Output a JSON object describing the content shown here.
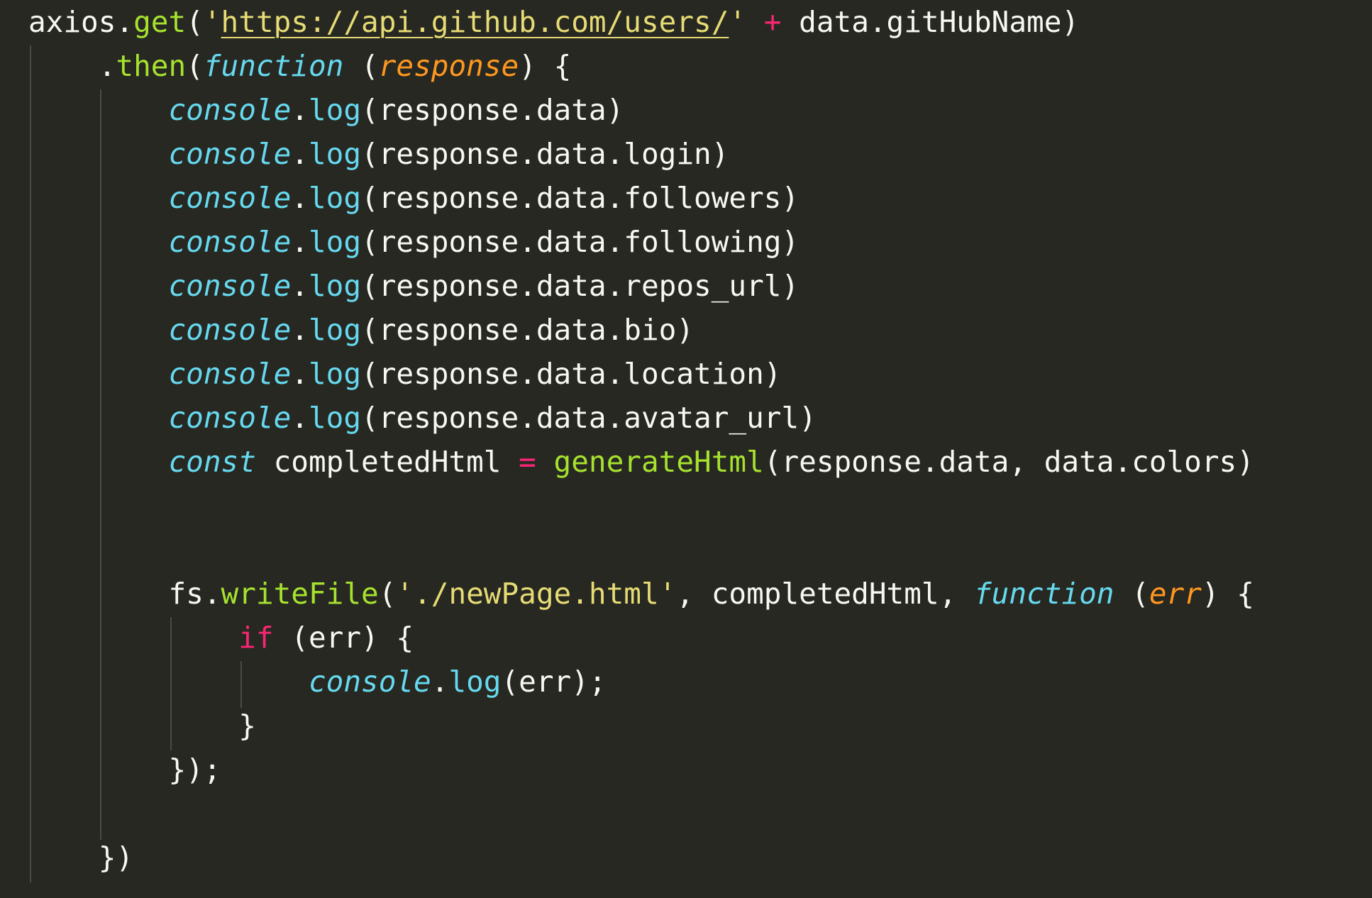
{
  "colors": {
    "background": "#272822",
    "plain": "#f8f8f2",
    "function": "#a6e22e",
    "string": "#e6db74",
    "operator": "#f92672",
    "keyword": "#66d9ef",
    "parameter": "#fd971f",
    "guide": "#4a4b44"
  },
  "lines": [
    [
      {
        "t": "plain",
        "v": "axios."
      },
      {
        "t": "func",
        "v": "get"
      },
      {
        "t": "plain",
        "v": "("
      },
      {
        "t": "str",
        "v": "'"
      },
      {
        "t": "url",
        "v": "https://api.github.com/users/"
      },
      {
        "t": "str",
        "v": "'"
      },
      {
        "t": "plain",
        "v": " "
      },
      {
        "t": "op",
        "v": "+"
      },
      {
        "t": "plain",
        "v": " data.gitHubName)"
      }
    ],
    [
      {
        "t": "plain",
        "v": "    ."
      },
      {
        "t": "func",
        "v": "then"
      },
      {
        "t": "plain",
        "v": "("
      },
      {
        "t": "kw",
        "v": "function"
      },
      {
        "t": "plain",
        "v": " ("
      },
      {
        "t": "param",
        "v": "response"
      },
      {
        "t": "plain",
        "v": ") {"
      }
    ],
    [
      {
        "t": "plain",
        "v": "        "
      },
      {
        "t": "obj",
        "v": "console"
      },
      {
        "t": "plain",
        "v": "."
      },
      {
        "t": "meth",
        "v": "log"
      },
      {
        "t": "plain",
        "v": "(response.data)"
      }
    ],
    [
      {
        "t": "plain",
        "v": "        "
      },
      {
        "t": "obj",
        "v": "console"
      },
      {
        "t": "plain",
        "v": "."
      },
      {
        "t": "meth",
        "v": "log"
      },
      {
        "t": "plain",
        "v": "(response.data.login)"
      }
    ],
    [
      {
        "t": "plain",
        "v": "        "
      },
      {
        "t": "obj",
        "v": "console"
      },
      {
        "t": "plain",
        "v": "."
      },
      {
        "t": "meth",
        "v": "log"
      },
      {
        "t": "plain",
        "v": "(response.data.followers)"
      }
    ],
    [
      {
        "t": "plain",
        "v": "        "
      },
      {
        "t": "obj",
        "v": "console"
      },
      {
        "t": "plain",
        "v": "."
      },
      {
        "t": "meth",
        "v": "log"
      },
      {
        "t": "plain",
        "v": "(response.data.following)"
      }
    ],
    [
      {
        "t": "plain",
        "v": "        "
      },
      {
        "t": "obj",
        "v": "console"
      },
      {
        "t": "plain",
        "v": "."
      },
      {
        "t": "meth",
        "v": "log"
      },
      {
        "t": "plain",
        "v": "(response.data.repos_url)"
      }
    ],
    [
      {
        "t": "plain",
        "v": "        "
      },
      {
        "t": "obj",
        "v": "console"
      },
      {
        "t": "plain",
        "v": "."
      },
      {
        "t": "meth",
        "v": "log"
      },
      {
        "t": "plain",
        "v": "(response.data.bio)"
      }
    ],
    [
      {
        "t": "plain",
        "v": "        "
      },
      {
        "t": "obj",
        "v": "console"
      },
      {
        "t": "plain",
        "v": "."
      },
      {
        "t": "meth",
        "v": "log"
      },
      {
        "t": "plain",
        "v": "(response.data.location)"
      }
    ],
    [
      {
        "t": "plain",
        "v": "        "
      },
      {
        "t": "obj",
        "v": "console"
      },
      {
        "t": "plain",
        "v": "."
      },
      {
        "t": "meth",
        "v": "log"
      },
      {
        "t": "plain",
        "v": "(response.data.avatar_url)"
      }
    ],
    [
      {
        "t": "plain",
        "v": "        "
      },
      {
        "t": "kw",
        "v": "const"
      },
      {
        "t": "plain",
        "v": " completedHtml "
      },
      {
        "t": "op",
        "v": "="
      },
      {
        "t": "plain",
        "v": " "
      },
      {
        "t": "func",
        "v": "generateHtml"
      },
      {
        "t": "plain",
        "v": "(response.data, data.colors)"
      }
    ],
    [],
    [],
    [
      {
        "t": "plain",
        "v": "        fs."
      },
      {
        "t": "func",
        "v": "writeFile"
      },
      {
        "t": "plain",
        "v": "("
      },
      {
        "t": "str",
        "v": "'./newPage.html'"
      },
      {
        "t": "plain",
        "v": ", completedHtml, "
      },
      {
        "t": "kw",
        "v": "function"
      },
      {
        "t": "plain",
        "v": " ("
      },
      {
        "t": "param",
        "v": "err"
      },
      {
        "t": "plain",
        "v": ") {"
      }
    ],
    [
      {
        "t": "plain",
        "v": "            "
      },
      {
        "t": "ctrl",
        "v": "if"
      },
      {
        "t": "plain",
        "v": " (err) {"
      }
    ],
    [
      {
        "t": "plain",
        "v": "                "
      },
      {
        "t": "obj",
        "v": "console"
      },
      {
        "t": "plain",
        "v": "."
      },
      {
        "t": "meth",
        "v": "log"
      },
      {
        "t": "plain",
        "v": "(err);"
      }
    ],
    [
      {
        "t": "plain",
        "v": "            }"
      }
    ],
    [
      {
        "t": "plain",
        "v": "        });"
      }
    ],
    [],
    [
      {
        "t": "plain",
        "v": "    })"
      }
    ]
  ]
}
